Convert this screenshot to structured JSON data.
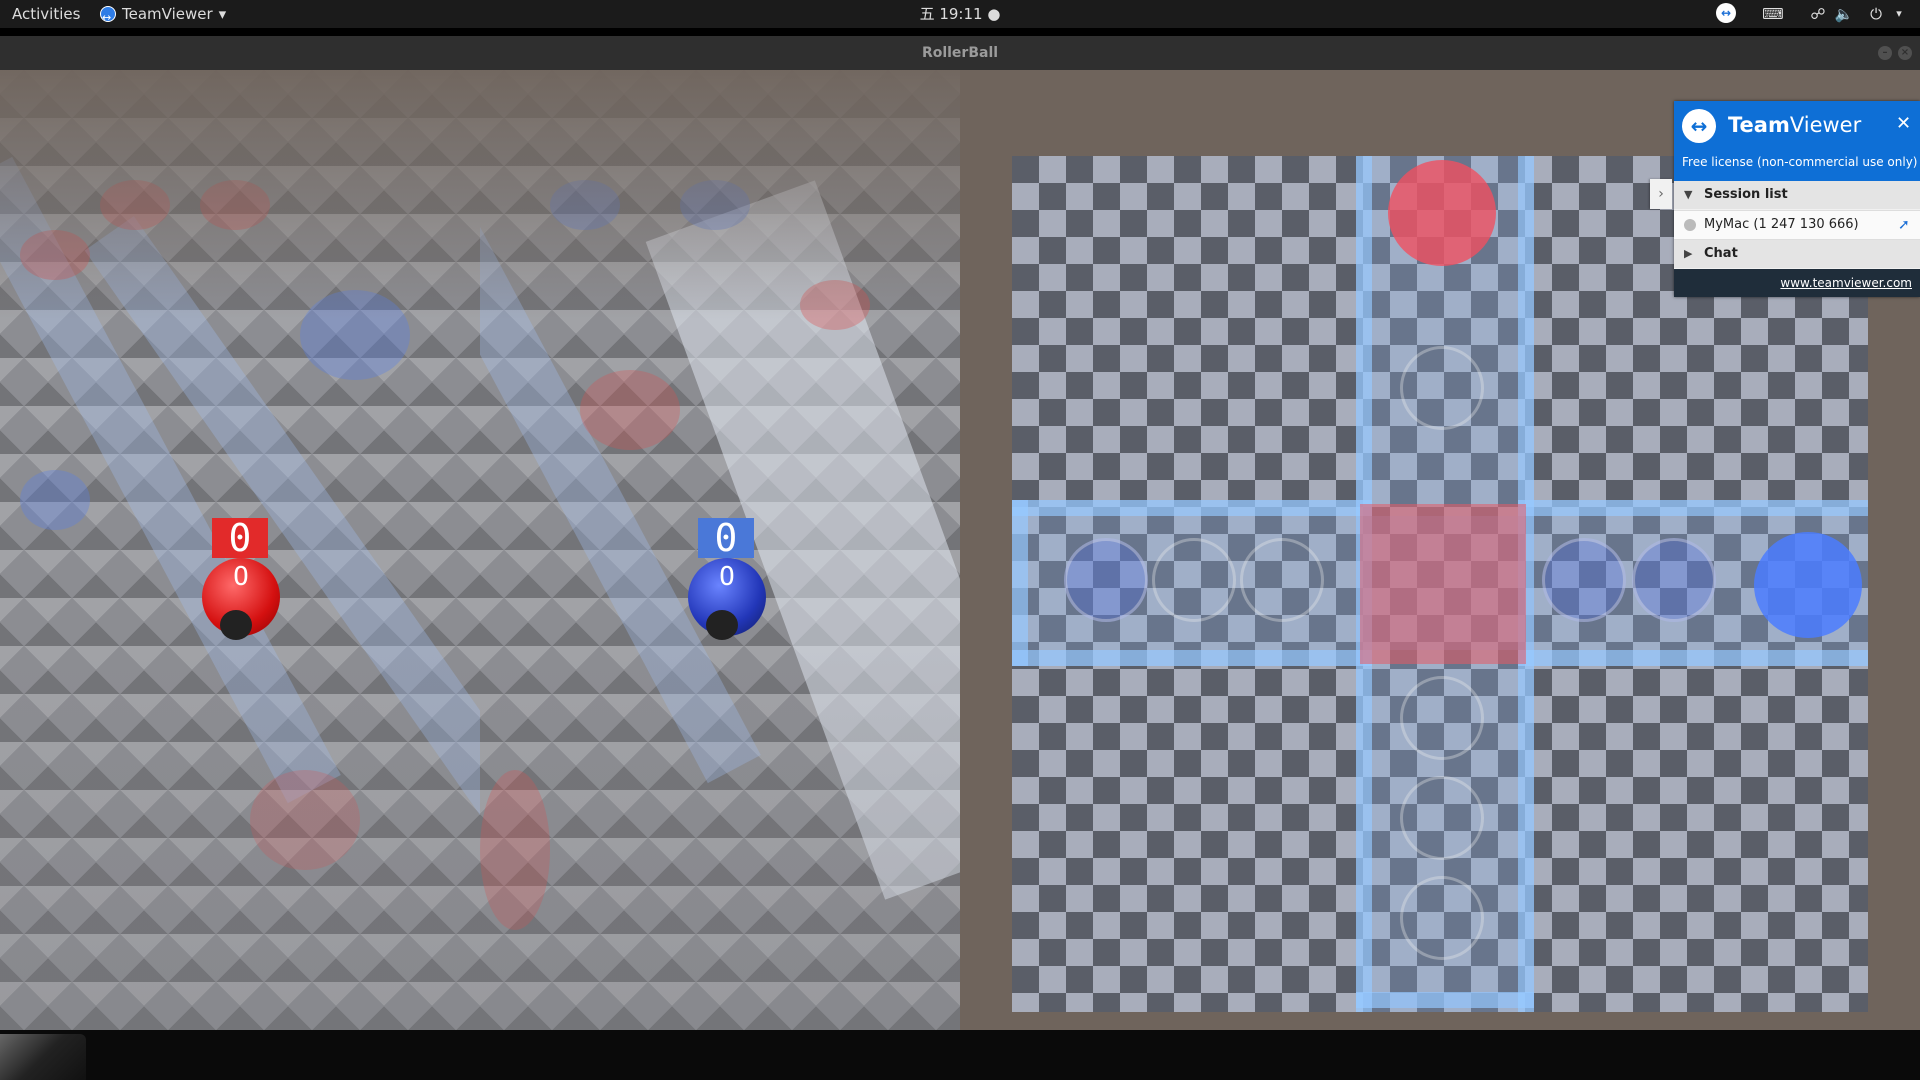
{
  "topbar": {
    "activities": "Activities",
    "app_name": "TeamViewer",
    "clock": "五 19:11 ●",
    "tray_icons": [
      "teamviewer-icon",
      "keyboard-icon",
      "network-icon",
      "volume-icon",
      "power-icon"
    ]
  },
  "window": {
    "title": "RollerBall"
  },
  "game": {
    "red_player": {
      "score_top": "0",
      "score_ball": "O",
      "color": "#e02020"
    },
    "blue_player": {
      "score_top": "0",
      "score_ball": "O",
      "color": "#2a44c8"
    },
    "map_colors": {
      "lane": "#9cc8ff",
      "red_goal": "#f05060",
      "blue_goal": "#4b7cff",
      "center_pad": "#e66070"
    }
  },
  "teamviewer": {
    "brand_bold": "Team",
    "brand_light": "Viewer",
    "close": "✕",
    "license": "Free license (non-commercial use only)",
    "session_list_label": "Session list",
    "session_item": "MyMac (1 247 130 666)",
    "chat_label": "Chat",
    "link": "www.teamviewer.com"
  }
}
